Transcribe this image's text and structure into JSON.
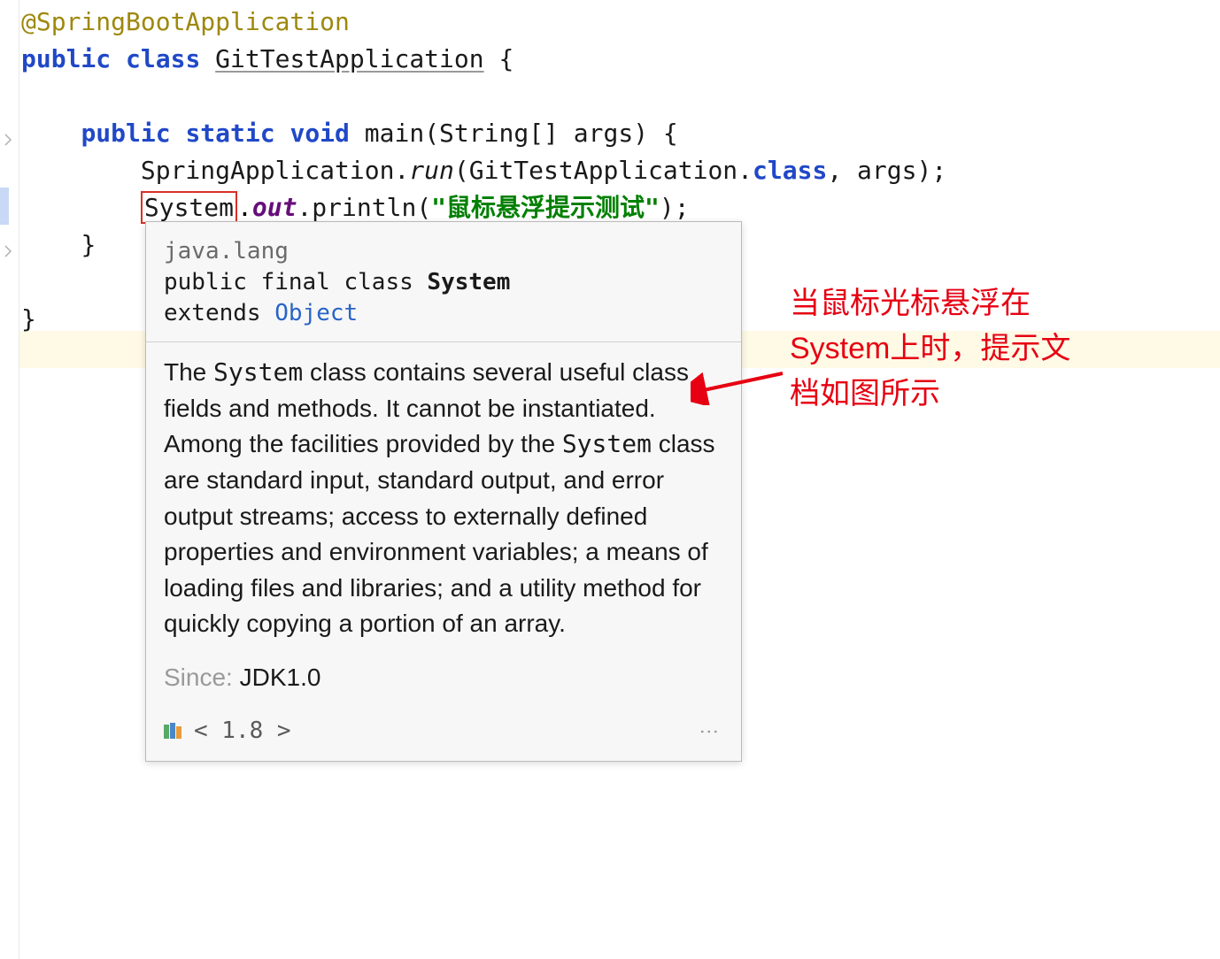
{
  "code": {
    "annotation": "@SpringBootApplication",
    "public": "public",
    "class": "class",
    "className": "GitTestApplication",
    "static": "static",
    "void": "void",
    "mainSig": "main(String[] args)",
    "springAppCall_pre": "SpringApplication.",
    "springAppCall_run": "run",
    "springAppCall_post": "(GitTestApplication.",
    "springAppCall_class": "class",
    "springAppCall_end": ", args);",
    "system": "System",
    "out": "out",
    "println": ".println(",
    "stringLit": "\"鼠标悬浮提示测试\"",
    "printlnEnd": ");"
  },
  "tooltip": {
    "package": "java.lang",
    "decl_prefix": "public final class ",
    "decl_name": "System",
    "extends": "extends ",
    "super": "Object",
    "body_p1_a": "The ",
    "body_p1_b": "System",
    "body_p1_c": " class contains several useful class fields and methods. It cannot be instantiated.",
    "body_p2_a": "Among the facilities provided by the ",
    "body_p2_b": "System",
    "body_p2_c": " class are standard input, standard output, and error output streams; access to externally defined properties and environment variables; a means of loading files and libraries; and a utility method for quickly copying a portion of an array.",
    "since_label": "Since:",
    "since_value": " JDK1.0",
    "footer_version": "< 1.8 >"
  },
  "annotation_note": "当鼠标光标悬浮在System上时，提示文档如图所示"
}
